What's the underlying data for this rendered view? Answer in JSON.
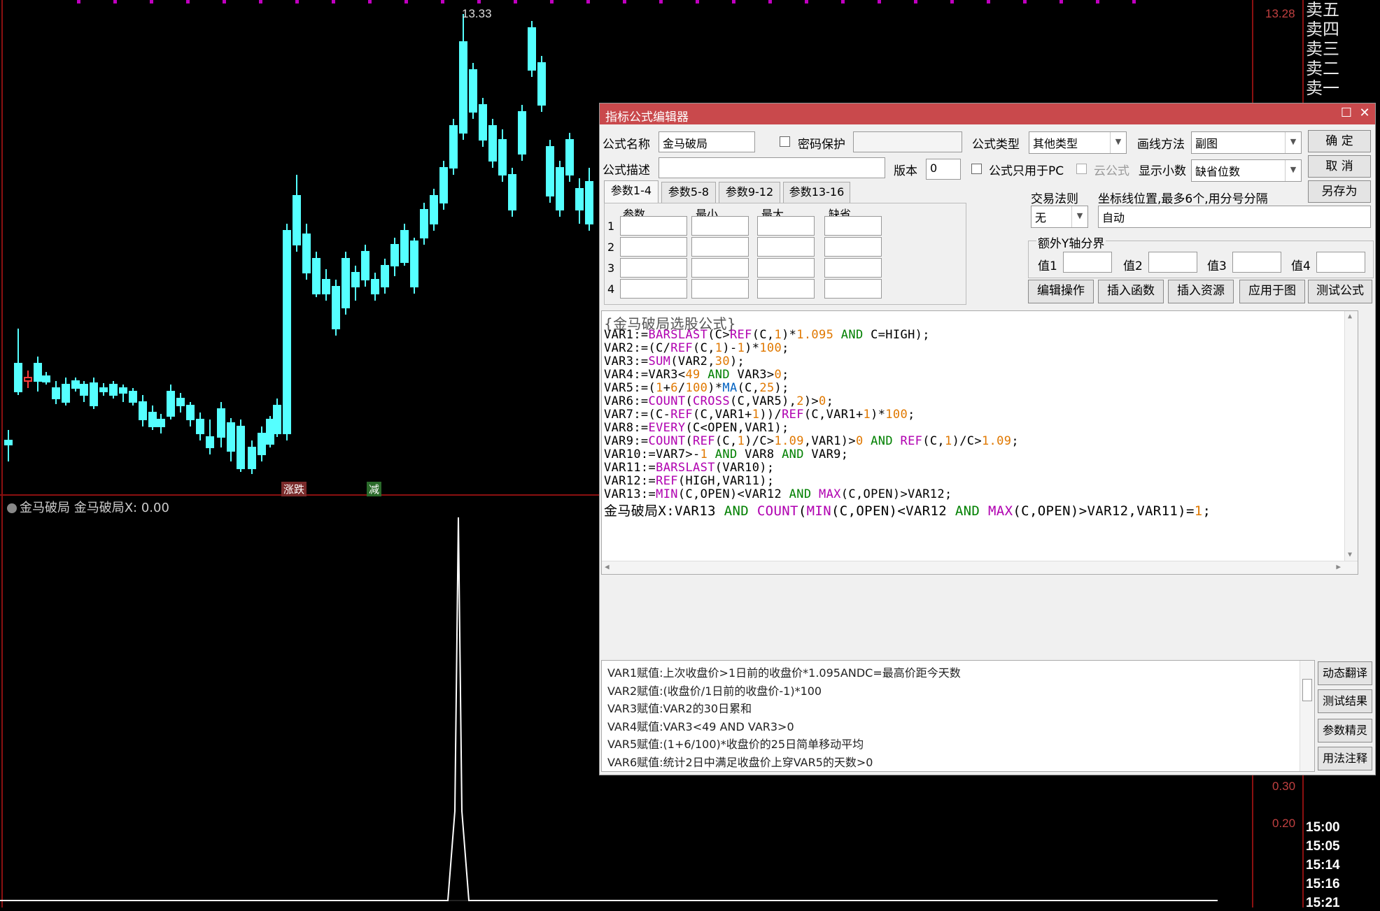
{
  "chart": {
    "high_label": "13.33",
    "price_axis": [
      "13.28"
    ],
    "sub_axis": [
      "0.30",
      "0.20"
    ],
    "badges": [
      "涨跌",
      "减"
    ],
    "indicator_header": "金马破局  金马破局X: 0.00",
    "order_book": [
      "卖五",
      "卖四",
      "卖三",
      "卖二",
      "卖一"
    ],
    "times": [
      "15:00",
      "15:05",
      "15:14",
      "15:16",
      "15:21"
    ],
    "colors": {
      "up": "#ff3b3b",
      "down": "#55ffff",
      "grid": "#8b1010",
      "line": "#ffffff"
    }
  },
  "dialog": {
    "title": "指标公式编辑器",
    "labels": {
      "name": "公式名称",
      "desc": "公式描述",
      "pwd": "密码保护",
      "version": "版本",
      "type": "公式类型",
      "draw": "画线方法",
      "pc_only": "公式只用于PC",
      "cloud": "云公式",
      "decimals": "显示小数",
      "trade_rule": "交易法则",
      "axis_pos": "坐标线位置,最多6个,用分号分隔",
      "extra_y": "额外Y轴分界",
      "v1": "值1",
      "v2": "值2",
      "v3": "值3",
      "v4": "值4"
    },
    "values": {
      "name": "金马破局",
      "version": "0",
      "type": "其他类型",
      "draw": "副图",
      "decimals": "缺省位数",
      "trade_rule": "无",
      "axis_pos": "自动"
    },
    "buttons": {
      "ok": "确  定",
      "cancel": "取  消",
      "save_as": "另存为",
      "edit_ops": "编辑操作",
      "insert_func": "插入函数",
      "insert_res": "插入资源",
      "apply": "应用于图",
      "test": "测试公式"
    },
    "tabs": [
      "参数1-4",
      "参数5-8",
      "参数9-12",
      "参数13-16"
    ],
    "param_headers": [
      "参数",
      "最小",
      "最大",
      "缺省"
    ],
    "param_rows": [
      "1",
      "2",
      "3",
      "4"
    ],
    "code_comment": "{金马破局选股公式}",
    "code_lines": [
      [
        [
          "VAR1:=",
          ""
        ],
        [
          "BARSLAST",
          "k"
        ],
        [
          "(C>",
          ""
        ],
        [
          "REF",
          "k"
        ],
        [
          "(C,",
          ""
        ],
        [
          "1",
          "n"
        ],
        [
          ")*",
          ""
        ],
        [
          "1.095",
          "n"
        ],
        [
          " AND ",
          "kw"
        ],
        [
          "C=HIGH);",
          ""
        ]
      ],
      [
        [
          "VAR2:=(C/",
          ""
        ],
        [
          "REF",
          "k"
        ],
        [
          "(C,",
          ""
        ],
        [
          "1",
          "n"
        ],
        [
          ")-",
          ""
        ],
        [
          "1",
          "n"
        ],
        [
          ")*",
          ""
        ],
        [
          "100",
          "n"
        ],
        [
          ";",
          ""
        ]
      ],
      [
        [
          "VAR3:=",
          ""
        ],
        [
          "SUM",
          "k"
        ],
        [
          "(VAR2,",
          ""
        ],
        [
          "30",
          "n"
        ],
        [
          ");",
          ""
        ]
      ],
      [
        [
          "VAR4:=VAR3<",
          ""
        ],
        [
          "49",
          "n"
        ],
        [
          " AND ",
          "kw"
        ],
        [
          "VAR3>",
          ""
        ],
        [
          "0",
          "n"
        ],
        [
          ";",
          ""
        ]
      ],
      [
        [
          "VAR5:=(",
          ""
        ],
        [
          "1",
          "n"
        ],
        [
          "+",
          ""
        ],
        [
          "6",
          "n"
        ],
        [
          "/",
          ""
        ],
        [
          "100",
          "n"
        ],
        [
          ")*",
          ""
        ],
        [
          "MA",
          "b"
        ],
        [
          "(C,",
          ""
        ],
        [
          "25",
          "n"
        ],
        [
          ");",
          ""
        ]
      ],
      [
        [
          "VAR6:=",
          ""
        ],
        [
          "COUNT",
          "k"
        ],
        [
          "(",
          ""
        ],
        [
          "CROSS",
          "k"
        ],
        [
          "(C,VAR5),",
          ""
        ],
        [
          "2",
          "n"
        ],
        [
          ")>",
          ""
        ],
        [
          "0",
          "n"
        ],
        [
          ";",
          ""
        ]
      ],
      [
        [
          "VAR7:=(C-",
          ""
        ],
        [
          "REF",
          "k"
        ],
        [
          "(C,VAR1+",
          ""
        ],
        [
          "1",
          "n"
        ],
        [
          "))/",
          ""
        ],
        [
          "REF",
          "k"
        ],
        [
          "(C,VAR1+",
          ""
        ],
        [
          "1",
          "n"
        ],
        [
          ")*",
          ""
        ],
        [
          "100",
          "n"
        ],
        [
          ";",
          ""
        ]
      ],
      [
        [
          "VAR8:=",
          ""
        ],
        [
          "EVERY",
          "k"
        ],
        [
          "(C<OPEN,VAR1);",
          ""
        ]
      ],
      [
        [
          "VAR9:=",
          ""
        ],
        [
          "COUNT",
          "k"
        ],
        [
          "(",
          ""
        ],
        [
          "REF",
          "k"
        ],
        [
          "(C,",
          ""
        ],
        [
          "1",
          "n"
        ],
        [
          ")/C>",
          ""
        ],
        [
          "1.09",
          "n"
        ],
        [
          ",VAR1)>",
          ""
        ],
        [
          "0",
          "n"
        ],
        [
          " AND ",
          "kw"
        ],
        [
          "REF",
          "k"
        ],
        [
          "(C,",
          ""
        ],
        [
          "1",
          "n"
        ],
        [
          ")/C>",
          ""
        ],
        [
          "1.09",
          "n"
        ],
        [
          ";",
          ""
        ]
      ],
      [
        [
          "VAR10:=VAR7>-",
          ""
        ],
        [
          "1",
          "n"
        ],
        [
          " AND ",
          "kw"
        ],
        [
          "VAR8",
          ""
        ],
        [
          " AND ",
          "kw"
        ],
        [
          "VAR9;",
          ""
        ]
      ],
      [
        [
          "VAR11:=",
          ""
        ],
        [
          "BARSLAST",
          "k"
        ],
        [
          "(VAR10);",
          ""
        ]
      ],
      [
        [
          "VAR12:=",
          ""
        ],
        [
          "REF",
          "k"
        ],
        [
          "(HIGH,VAR11);",
          ""
        ]
      ],
      [
        [
          "VAR13:=",
          ""
        ],
        [
          "MIN",
          "k"
        ],
        [
          "(C,OPEN)<VAR12",
          ""
        ],
        [
          " AND ",
          "kw"
        ],
        [
          "MAX",
          "k"
        ],
        [
          "(C,OPEN)>VAR12;",
          ""
        ]
      ],
      [
        [
          "金马破局X:VAR13",
          ""
        ],
        [
          " AND ",
          "kw"
        ],
        [
          "COUNT",
          "k"
        ],
        [
          "(",
          ""
        ],
        [
          "MIN",
          "k"
        ],
        [
          "(C,OPEN)<VAR12",
          ""
        ],
        [
          " AND ",
          "kw"
        ],
        [
          "MAX",
          "k"
        ],
        [
          "(C,OPEN)>VAR12,VAR11)=",
          ""
        ],
        [
          "1",
          "n"
        ],
        [
          ";",
          ""
        ]
      ]
    ],
    "translations": [
      "VAR1赋值:上次收盘价>1日前的收盘价*1.095ANDC=最高价距今天数",
      "VAR2赋值:(收盘价/1日前的收盘价-1)*100",
      "VAR3赋值:VAR2的30日累和",
      "VAR4赋值:VAR3<49 AND VAR3>0",
      "VAR5赋值:(1+6/100)*收盘价的25日简单移动平均",
      "VAR6赋值:统计2日中满足收盘价上穿VAR5的天数>0"
    ],
    "side_buttons": [
      "动态翻译",
      "测试结果",
      "参数精灵",
      "用法注释"
    ]
  }
}
